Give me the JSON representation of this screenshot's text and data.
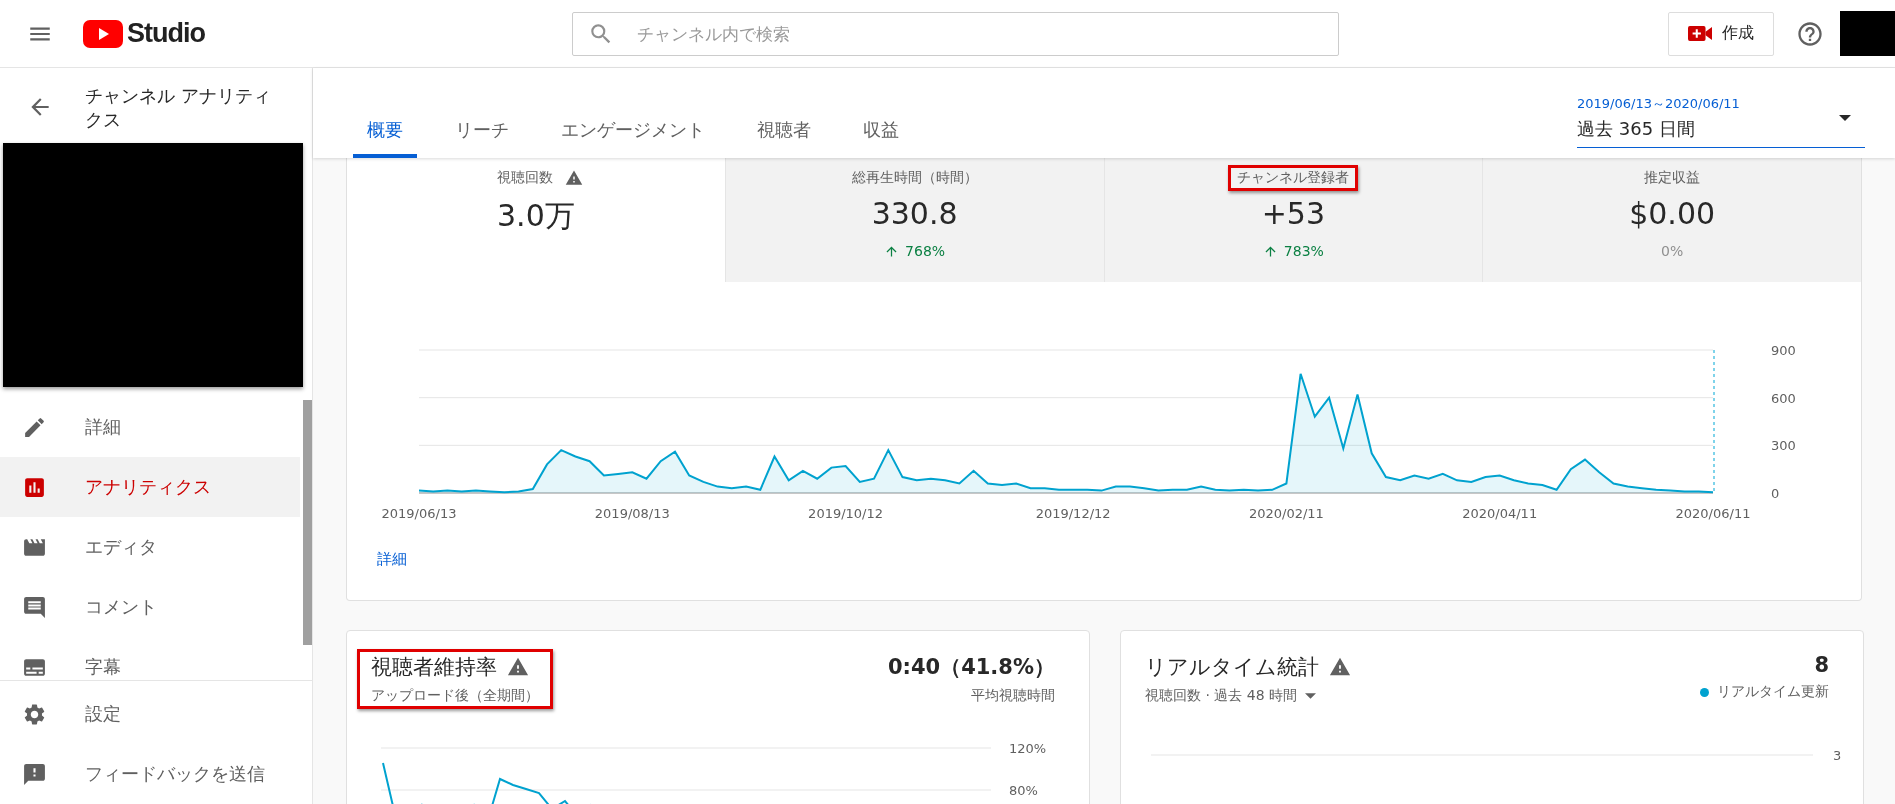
{
  "topbar": {
    "logo_text": "Studio",
    "search": {
      "placeholder": "チャンネル内で検索"
    },
    "create_button": "作成"
  },
  "sidebar": {
    "title": "チャンネル アナリティクス",
    "items": [
      {
        "label": "詳細",
        "selected": false
      },
      {
        "label": "アナリティクス",
        "selected": true
      },
      {
        "label": "エディタ",
        "selected": false
      },
      {
        "label": "コメント",
        "selected": false
      },
      {
        "label": "字幕",
        "selected": false
      }
    ],
    "footer_items": [
      {
        "label": "設定"
      },
      {
        "label": "フィードバックを送信"
      }
    ]
  },
  "tabs": [
    {
      "label": "概要",
      "selected": true
    },
    {
      "label": "リーチ",
      "selected": false
    },
    {
      "label": "エンゲージメント",
      "selected": false
    },
    {
      "label": "視聴者",
      "selected": false
    },
    {
      "label": "収益",
      "selected": false
    }
  ],
  "date_range": {
    "range": "2019/06/13～2020/06/11",
    "label": "過去 365 日間"
  },
  "metrics": [
    {
      "label": "視聴回数",
      "value": "3.0万",
      "selected": true,
      "warning": true,
      "highlighted": false
    },
    {
      "label": "総再生時間（時間）",
      "value": "330.8",
      "change": "768%",
      "rising": true,
      "selected": false,
      "warning": false,
      "highlighted": false
    },
    {
      "label": "チャンネル登録者",
      "value": "+53",
      "change": "783%",
      "rising": true,
      "selected": false,
      "warning": false,
      "highlighted": true
    },
    {
      "label": "推定収益",
      "value": "$0.00",
      "change": "0%",
      "rising": false,
      "selected": false,
      "warning": false,
      "highlighted": false
    }
  ],
  "overview_chart": {
    "chart_data": {
      "type": "area",
      "ylim": [
        0,
        900
      ],
      "yticks": [
        0,
        300,
        600,
        900
      ],
      "categories": [
        "2019/06/13",
        null,
        null,
        null,
        null,
        null,
        null,
        null,
        null,
        null,
        null,
        null,
        null,
        null,
        null,
        "2019/08/13",
        null,
        null,
        null,
        null,
        null,
        null,
        null,
        null,
        null,
        null,
        null,
        null,
        null,
        null,
        "2019/10/12",
        null,
        null,
        null,
        null,
        null,
        null,
        null,
        null,
        null,
        null,
        null,
        null,
        null,
        null,
        null,
        "2019/12/12",
        null,
        null,
        null,
        null,
        null,
        null,
        null,
        null,
        null,
        null,
        null,
        null,
        null,
        null,
        "2020/02/11",
        null,
        null,
        null,
        null,
        null,
        null,
        null,
        null,
        null,
        null,
        null,
        null,
        null,
        null,
        "2020/04/11",
        null,
        null,
        null,
        null,
        null,
        null,
        null,
        null,
        null,
        null,
        null,
        null,
        null,
        null,
        "2020/06/11"
      ],
      "series": [
        {
          "color": "#00a2cf",
          "values": [
            15,
            10,
            15,
            10,
            15,
            10,
            5,
            10,
            25,
            180,
            270,
            230,
            200,
            110,
            120,
            130,
            90,
            200,
            260,
            110,
            70,
            40,
            30,
            40,
            20,
            230,
            80,
            140,
            90,
            160,
            170,
            70,
            90,
            270,
            100,
            80,
            90,
            80,
            60,
            140,
            60,
            50,
            60,
            30,
            30,
            20,
            20,
            20,
            15,
            40,
            40,
            30,
            15,
            20,
            20,
            40,
            20,
            15,
            20,
            15,
            20,
            60,
            750,
            480,
            600,
            280,
            620,
            250,
            100,
            80,
            110,
            90,
            120,
            80,
            70,
            100,
            110,
            80,
            60,
            50,
            20,
            150,
            210,
            130,
            60,
            40,
            30,
            20,
            15,
            10,
            10,
            5
          ]
        }
      ]
    }
  },
  "details_link": "詳細",
  "retention": {
    "title": "視聴者維持率",
    "warning": true,
    "subtitle": "アップロード後（全期間）",
    "value": "0:40（41.8%）",
    "value_caption": "平均視聴時間",
    "highlighted": true,
    "tick_labels": [
      "120%",
      "80%"
    ]
  },
  "realtime": {
    "title": "リアルタイム統計",
    "warning": true,
    "value": "8",
    "subtitle": "視聴回数 · 過去 48 時間",
    "status": "リアルタイム更新",
    "tick_labels": [
      "3"
    ]
  }
}
